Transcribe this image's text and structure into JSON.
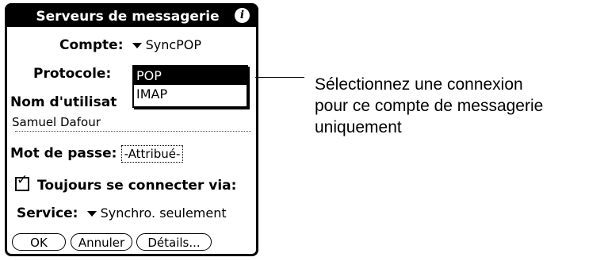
{
  "window": {
    "title": "Serveurs de messagerie",
    "info_icon": "info-icon"
  },
  "account": {
    "label": "Compte:",
    "value": "SyncPOP"
  },
  "protocol": {
    "label": "Protocole:",
    "options": [
      "POP",
      "IMAP"
    ],
    "selected": "POP"
  },
  "username": {
    "label": "Nom d'utilisat",
    "value": "Samuel Dafour"
  },
  "password": {
    "label": "Mot de passe:",
    "value": "-Attribué-"
  },
  "always_connect": {
    "label": "Toujours se connecter via:",
    "checked": true
  },
  "service": {
    "label": "Service:",
    "value": "Synchro. seulement"
  },
  "buttons": {
    "ok": "OK",
    "cancel": "Annuler",
    "details": "Détails..."
  },
  "callout": {
    "lines": [
      "Sélectionnez une connexion",
      "pour ce compte de messagerie",
      "uniquement"
    ]
  }
}
